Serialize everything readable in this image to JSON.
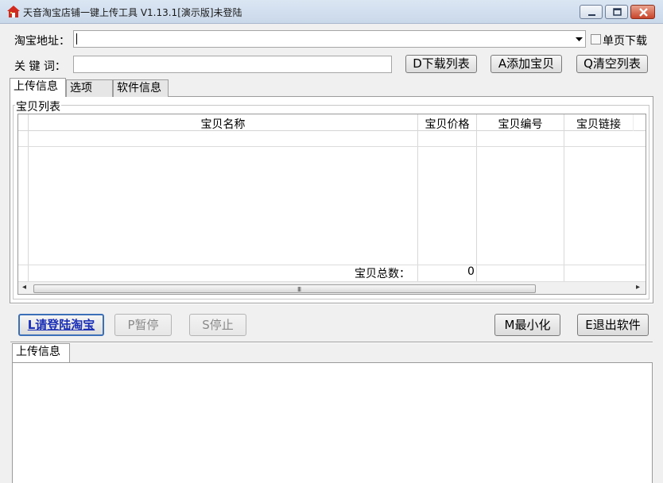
{
  "window": {
    "title": "天音淘宝店铺一键上传工具 V1.13.1[演示版]未登陆",
    "icon": "house-icon"
  },
  "form": {
    "url_label": "淘宝地址：",
    "url_value": "",
    "single_page_label": "单页下载",
    "keyword_label": "关 键 词：",
    "keyword_value": ""
  },
  "toolbar": {
    "download_list": "D下载列表",
    "add_item": "A添加宝贝",
    "clear_list": "Q清空列表"
  },
  "tabs": [
    "上传信息",
    "选项",
    "软件信息"
  ],
  "group": {
    "title": "宝贝列表"
  },
  "table": {
    "columns": [
      "宝贝名称",
      "宝贝价格",
      "宝贝编号",
      "宝贝链接"
    ],
    "total_label": "宝贝总数：",
    "total_value": "0",
    "scroll_grip": "III"
  },
  "actions": {
    "login": "L请登陆淘宝",
    "pause": "P暂停",
    "stop": "S停止",
    "minimize": "M最小化",
    "exit": "E退出软件"
  },
  "log_tab": "上传信息",
  "colors": {
    "accent": "#1a2fb5",
    "titlebar": "#dbe6f3",
    "close": "#c8452b"
  }
}
